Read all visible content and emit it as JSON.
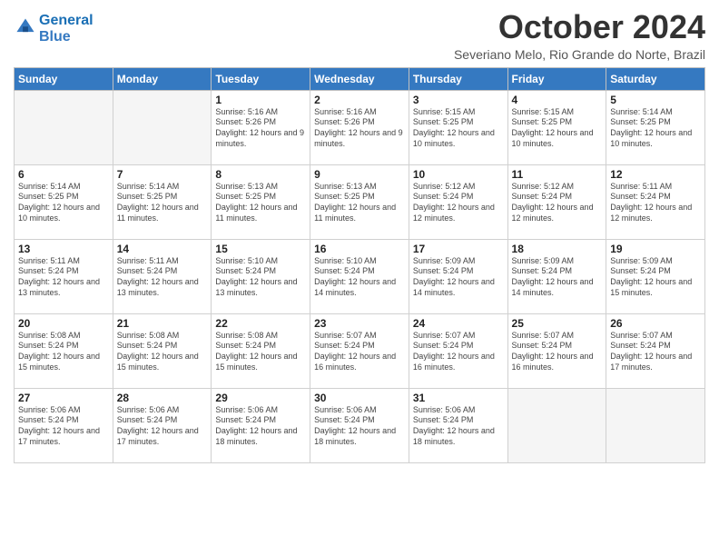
{
  "logo": {
    "line1": "General",
    "line2": "Blue"
  },
  "title": "October 2024",
  "subtitle": "Severiano Melo, Rio Grande do Norte, Brazil",
  "days_header": [
    "Sunday",
    "Monday",
    "Tuesday",
    "Wednesday",
    "Thursday",
    "Friday",
    "Saturday"
  ],
  "weeks": [
    [
      {
        "day": "",
        "info": ""
      },
      {
        "day": "",
        "info": ""
      },
      {
        "day": "1",
        "info": "Sunrise: 5:16 AM\nSunset: 5:26 PM\nDaylight: 12 hours and 9 minutes."
      },
      {
        "day": "2",
        "info": "Sunrise: 5:16 AM\nSunset: 5:26 PM\nDaylight: 12 hours and 9 minutes."
      },
      {
        "day": "3",
        "info": "Sunrise: 5:15 AM\nSunset: 5:25 PM\nDaylight: 12 hours and 10 minutes."
      },
      {
        "day": "4",
        "info": "Sunrise: 5:15 AM\nSunset: 5:25 PM\nDaylight: 12 hours and 10 minutes."
      },
      {
        "day": "5",
        "info": "Sunrise: 5:14 AM\nSunset: 5:25 PM\nDaylight: 12 hours and 10 minutes."
      }
    ],
    [
      {
        "day": "6",
        "info": "Sunrise: 5:14 AM\nSunset: 5:25 PM\nDaylight: 12 hours and 10 minutes."
      },
      {
        "day": "7",
        "info": "Sunrise: 5:14 AM\nSunset: 5:25 PM\nDaylight: 12 hours and 11 minutes."
      },
      {
        "day": "8",
        "info": "Sunrise: 5:13 AM\nSunset: 5:25 PM\nDaylight: 12 hours and 11 minutes."
      },
      {
        "day": "9",
        "info": "Sunrise: 5:13 AM\nSunset: 5:25 PM\nDaylight: 12 hours and 11 minutes."
      },
      {
        "day": "10",
        "info": "Sunrise: 5:12 AM\nSunset: 5:24 PM\nDaylight: 12 hours and 12 minutes."
      },
      {
        "day": "11",
        "info": "Sunrise: 5:12 AM\nSunset: 5:24 PM\nDaylight: 12 hours and 12 minutes."
      },
      {
        "day": "12",
        "info": "Sunrise: 5:11 AM\nSunset: 5:24 PM\nDaylight: 12 hours and 12 minutes."
      }
    ],
    [
      {
        "day": "13",
        "info": "Sunrise: 5:11 AM\nSunset: 5:24 PM\nDaylight: 12 hours and 13 minutes."
      },
      {
        "day": "14",
        "info": "Sunrise: 5:11 AM\nSunset: 5:24 PM\nDaylight: 12 hours and 13 minutes."
      },
      {
        "day": "15",
        "info": "Sunrise: 5:10 AM\nSunset: 5:24 PM\nDaylight: 12 hours and 13 minutes."
      },
      {
        "day": "16",
        "info": "Sunrise: 5:10 AM\nSunset: 5:24 PM\nDaylight: 12 hours and 14 minutes."
      },
      {
        "day": "17",
        "info": "Sunrise: 5:09 AM\nSunset: 5:24 PM\nDaylight: 12 hours and 14 minutes."
      },
      {
        "day": "18",
        "info": "Sunrise: 5:09 AM\nSunset: 5:24 PM\nDaylight: 12 hours and 14 minutes."
      },
      {
        "day": "19",
        "info": "Sunrise: 5:09 AM\nSunset: 5:24 PM\nDaylight: 12 hours and 15 minutes."
      }
    ],
    [
      {
        "day": "20",
        "info": "Sunrise: 5:08 AM\nSunset: 5:24 PM\nDaylight: 12 hours and 15 minutes."
      },
      {
        "day": "21",
        "info": "Sunrise: 5:08 AM\nSunset: 5:24 PM\nDaylight: 12 hours and 15 minutes."
      },
      {
        "day": "22",
        "info": "Sunrise: 5:08 AM\nSunset: 5:24 PM\nDaylight: 12 hours and 15 minutes."
      },
      {
        "day": "23",
        "info": "Sunrise: 5:07 AM\nSunset: 5:24 PM\nDaylight: 12 hours and 16 minutes."
      },
      {
        "day": "24",
        "info": "Sunrise: 5:07 AM\nSunset: 5:24 PM\nDaylight: 12 hours and 16 minutes."
      },
      {
        "day": "25",
        "info": "Sunrise: 5:07 AM\nSunset: 5:24 PM\nDaylight: 12 hours and 16 minutes."
      },
      {
        "day": "26",
        "info": "Sunrise: 5:07 AM\nSunset: 5:24 PM\nDaylight: 12 hours and 17 minutes."
      }
    ],
    [
      {
        "day": "27",
        "info": "Sunrise: 5:06 AM\nSunset: 5:24 PM\nDaylight: 12 hours and 17 minutes."
      },
      {
        "day": "28",
        "info": "Sunrise: 5:06 AM\nSunset: 5:24 PM\nDaylight: 12 hours and 17 minutes."
      },
      {
        "day": "29",
        "info": "Sunrise: 5:06 AM\nSunset: 5:24 PM\nDaylight: 12 hours and 18 minutes."
      },
      {
        "day": "30",
        "info": "Sunrise: 5:06 AM\nSunset: 5:24 PM\nDaylight: 12 hours and 18 minutes."
      },
      {
        "day": "31",
        "info": "Sunrise: 5:06 AM\nSunset: 5:24 PM\nDaylight: 12 hours and 18 minutes."
      },
      {
        "day": "",
        "info": ""
      },
      {
        "day": "",
        "info": ""
      }
    ]
  ]
}
